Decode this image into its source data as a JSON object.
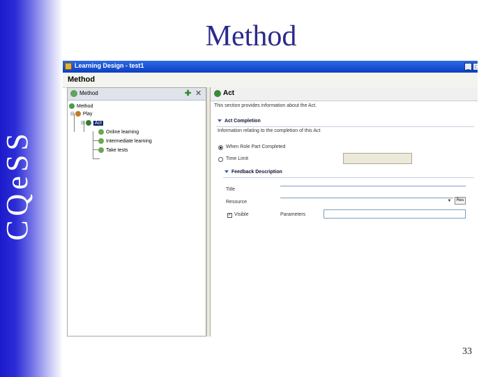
{
  "slide": {
    "title": "Method",
    "logo_text": "CQeSS",
    "page_number": "33"
  },
  "colors": {
    "sidebar_gradient_start": "#1a1acc",
    "title": "#2a2a8c",
    "window_titlebar": "#0b3ec4",
    "selection": "#0a246a"
  },
  "window": {
    "title": "Learning Design - test1",
    "editor_title": "Method"
  },
  "tree_panel": {
    "header_label": "Method",
    "nodes": [
      {
        "label": "Method",
        "icon": "method-icon"
      },
      {
        "label": "Play",
        "icon": "play-icon"
      },
      {
        "label": "Act",
        "icon": "act-icon",
        "selected": true
      },
      {
        "label": "Online learning",
        "icon": "role-part-icon"
      },
      {
        "label": "Intermediate learning",
        "icon": "role-part-icon"
      },
      {
        "label": "Take tests",
        "icon": "role-part-icon"
      }
    ]
  },
  "act_panel": {
    "title": "Act",
    "description": "This section provides information about the Act.",
    "completion": {
      "section_label": "Act Completion",
      "info": "Information relating to the completion of this Act",
      "option1": "When Role Part Completed",
      "option2": "Time Limit",
      "selected_option": "When Role Part Completed"
    },
    "feedback": {
      "section_label": "Feedback Description",
      "title_label": "Title",
      "resource_label": "Resource",
      "resource_button": "Res",
      "visible_label": "Visible",
      "visible_checked": true,
      "parameters_label": "Parameters"
    }
  }
}
